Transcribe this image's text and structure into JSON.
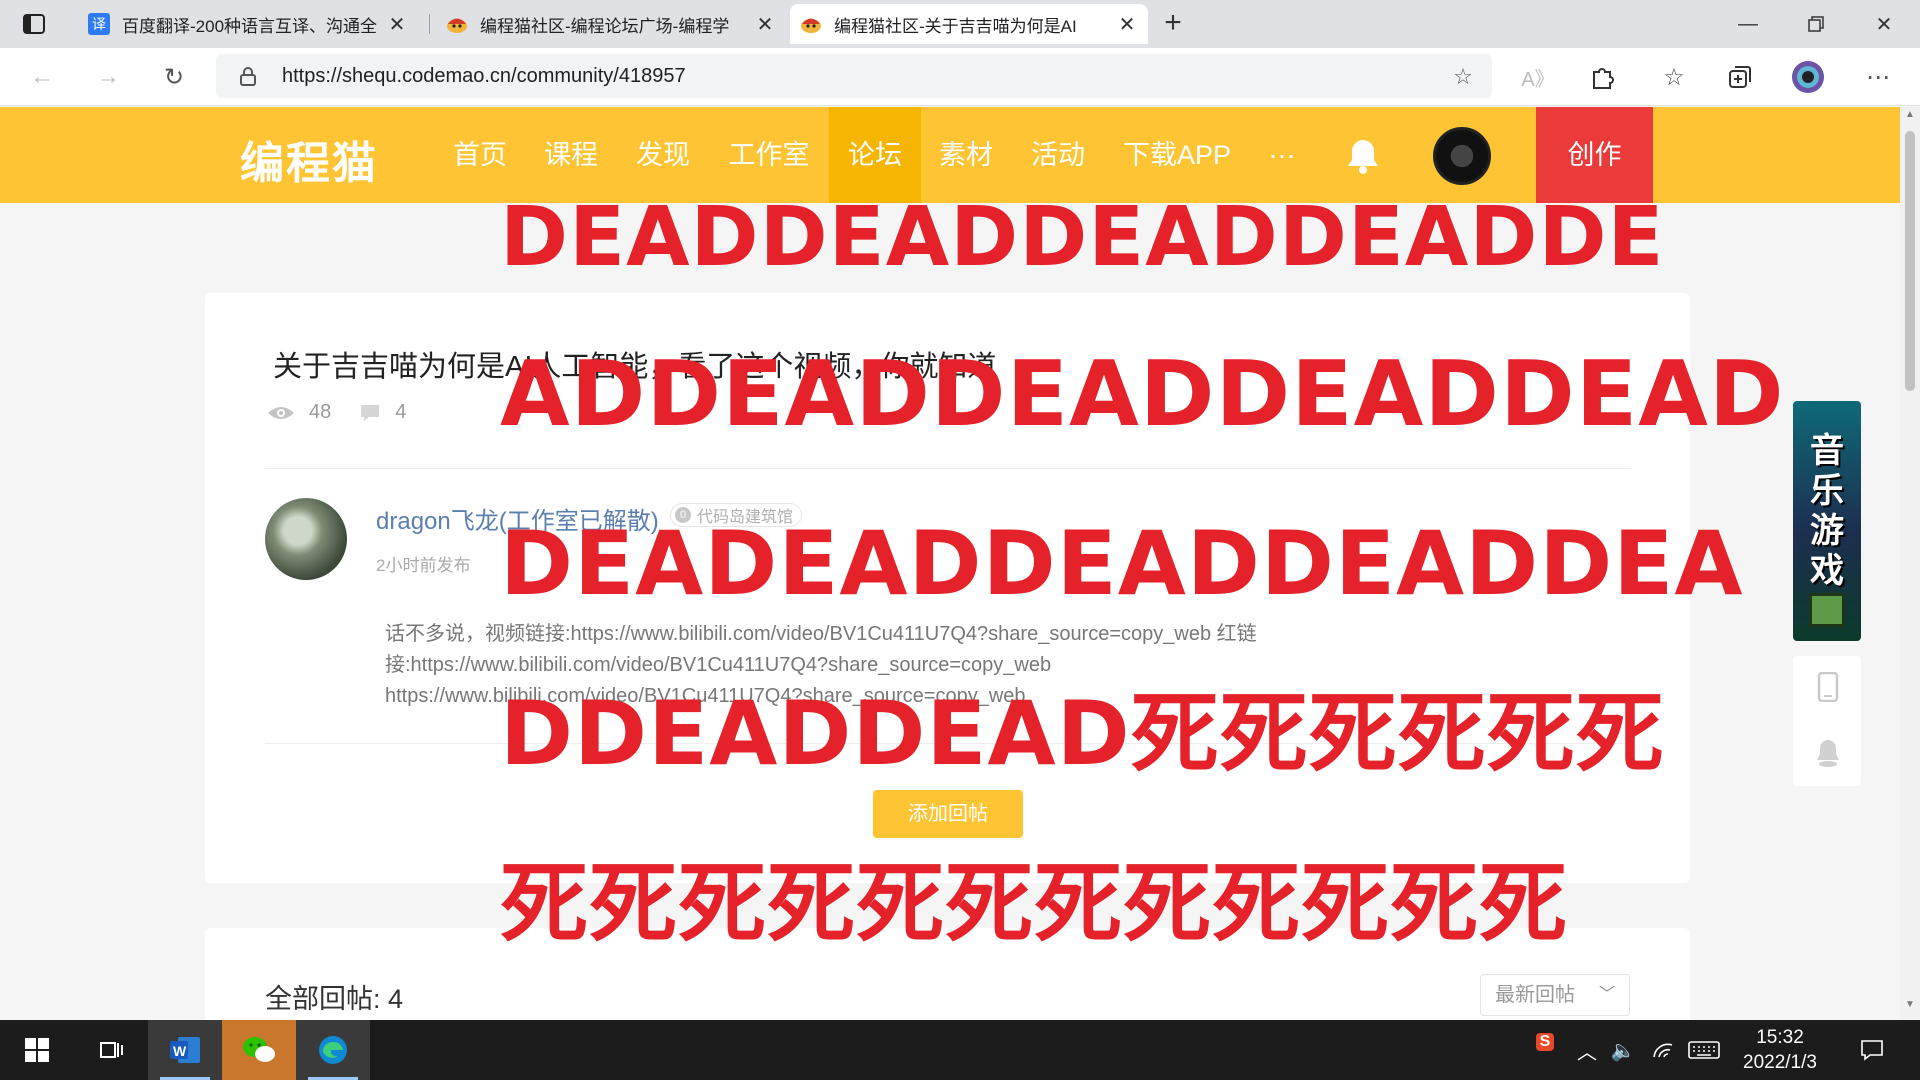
{
  "browser": {
    "tabs": [
      {
        "title": "百度翻译-200种语言互译、沟通全",
        "favicon": "译",
        "active": false
      },
      {
        "title": "编程猫社区-编程论坛广场-编程学",
        "favicon": "",
        "active": false
      },
      {
        "title": "编程猫社区-关于吉吉喵为何是AI",
        "favicon": "",
        "active": true
      }
    ],
    "new_tab": "+",
    "window_controls": [
      "minimize",
      "maximize",
      "close"
    ],
    "url": "https://shequ.codemao.cn/community/418957"
  },
  "site": {
    "logo": "编程猫",
    "nav": [
      "首页",
      "课程",
      "发现",
      "工作室",
      "论坛",
      "素材",
      "活动",
      "下载APP",
      "···"
    ],
    "active_nav": "论坛",
    "create_label": "创作",
    "accent_color": "#fec433",
    "create_color": "#ea3a3a"
  },
  "post": {
    "title": "关于吉吉喵为何是AI人工智能，看了这个视频，你就知道",
    "views": "48",
    "comments": "4",
    "author": "dragon飞龙(工作室已解散)",
    "badge": "代码岛建筑馆",
    "time": "2小时前发布",
    "body_lines": [
      "话不多说，视频链接:https://www.bilibili.com/video/BV1Cu411U7Q4?share_source=copy_web 红链",
      "接:https://www.bilibili.com/video/BV1Cu411U7Q4?share_source=copy_web",
      "https://www.bilibili.com/video/BV1Cu411U7Q4?share_source=copy_web"
    ],
    "reply_button": "添加回帖"
  },
  "replies": {
    "count_label": "全部回帖: 4",
    "sort_label": "最新回帖"
  },
  "side": {
    "banner_text": "音乐游戏"
  },
  "overlay": [
    "DEADDEADDEADDEADDE",
    "ADDEADDEADDEADDEAD",
    "DEADEADDEADDEADDEA",
    "DDEADDEAD死死死死死死",
    "死死死死死死死死死死死死"
  ],
  "taskbar": {
    "time": "15:32",
    "date": "2022/1/3"
  }
}
